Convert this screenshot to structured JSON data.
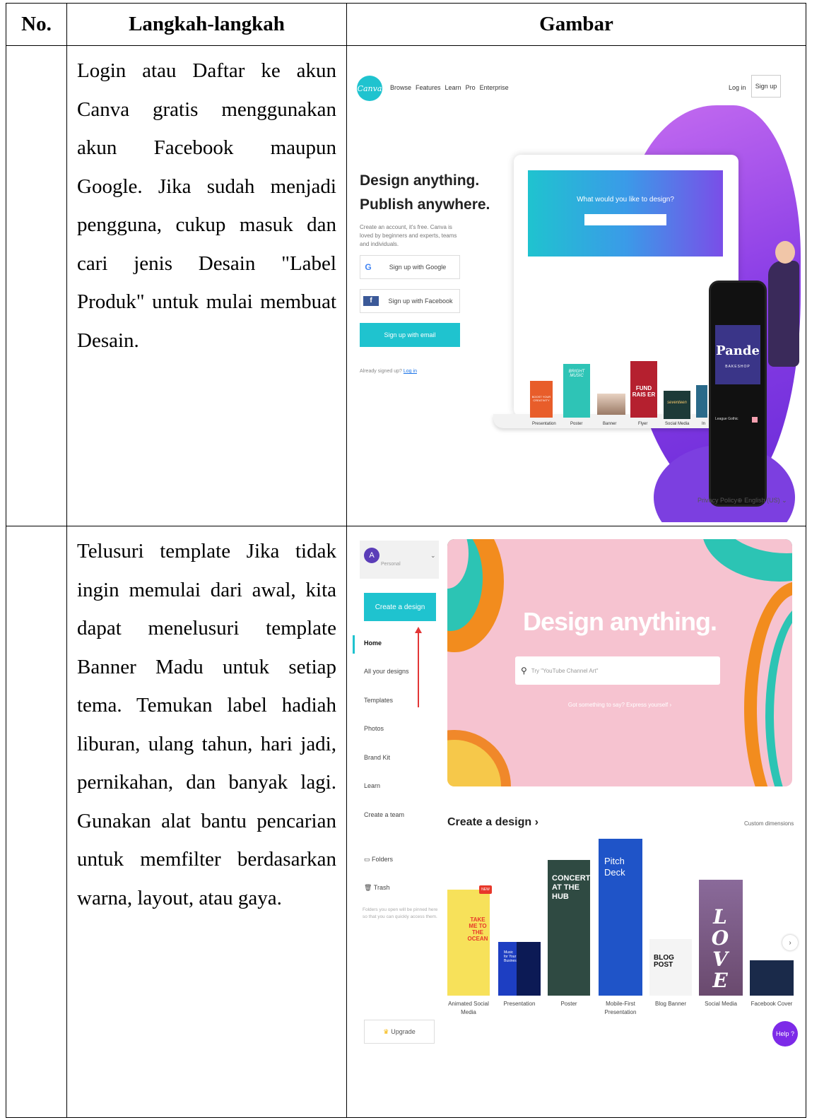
{
  "table": {
    "headers": [
      "No.",
      "Langkah-langkah",
      "Gambar"
    ],
    "rows": [
      {
        "no": "",
        "text": "Login atau Daftar ke akun Canva gratis menggunakan akun Facebook maupun Google. Jika sudah menjadi pengguna, cukup masuk dan cari jenis Desain \"Label Produk\" untuk mulai membuat Desain."
      },
      {
        "no": "",
        "text": "Telusuri template Jika tidak ingin memulai dari awal, kita dapat menelusuri template Banner Madu untuk setiap tema. Temukan label hadiah liburan, ulang tahun, hari jadi, pernikahan, dan banyak lagi. Gunakan alat bantu pencarian untuk memfilter berdasarkan warna, layout, atau gaya."
      }
    ]
  },
  "shot1": {
    "logo": "Canva",
    "nav": [
      "Browse",
      "Features",
      "Learn",
      "Pro",
      "Enterprise"
    ],
    "login": "Log in",
    "signup": "Sign up",
    "headline1": "Design anything.",
    "headline2": "Publish anywhere.",
    "subtext": "Create an account, it's free. Canva is loved by beginners and experts, teams and individuals.",
    "google_btn": "Sign up with Google",
    "facebook_btn": "Sign up with Facebook",
    "email_btn": "Sign up with email",
    "already": "Already signed up?",
    "already_link": "Log in",
    "hero_question": "What would you like to design?",
    "categories": [
      "Presentation",
      "Poster",
      "Banner",
      "Flyer",
      "Social Media",
      "In"
    ],
    "card_poster": "BRIGHT MUSIC",
    "card_flyer": "FUND RAIS ER",
    "card_social": "seventeen",
    "card_pres": "BOOST YOUR CREATIVITY",
    "phone_brand": "Pande",
    "phone_sub": "BAKESHOP",
    "phone_font": "League Gothic",
    "privacy": "Privacy Policy",
    "language": "English (US)",
    "colors": {
      "teal": "#1fc3cf",
      "purple": "#7d2ae8"
    }
  },
  "shot2": {
    "avatar": "A",
    "account": "Personal",
    "create_btn": "Create a design",
    "sidebar": [
      "Home",
      "All your designs",
      "Templates",
      "Photos",
      "Brand Kit",
      "Learn",
      "Create a team"
    ],
    "folders": "Folders",
    "trash": "Trash",
    "folder_note": "Folders you open will be pinned here so that you can quickly access them.",
    "upgrade": "Upgrade",
    "banner_title": "Design anything.",
    "search_placeholder": "Try \"YouTube Channel Art\"",
    "banner_tagline": "Got something to say? Express yourself ›",
    "create_heading": "Create a design ›",
    "custom_dims": "Custom dimensions",
    "tiles": [
      {
        "caption": "Animated Social Media",
        "text": "TAKE ME TO THE OCEAN",
        "badge": "NEW"
      },
      {
        "caption": "Presentation",
        "text": "Music for Your Business"
      },
      {
        "caption": "Poster",
        "text": "CONCERT AT THE HUB"
      },
      {
        "caption": "Mobile-First Presentation",
        "text": "Pitch Deck"
      },
      {
        "caption": "Blog Banner",
        "text": "BLOG POST"
      },
      {
        "caption": "Social Media",
        "text": "LOVE"
      },
      {
        "caption": "Facebook Cover",
        "text": ""
      }
    ],
    "help": "Help ?"
  }
}
